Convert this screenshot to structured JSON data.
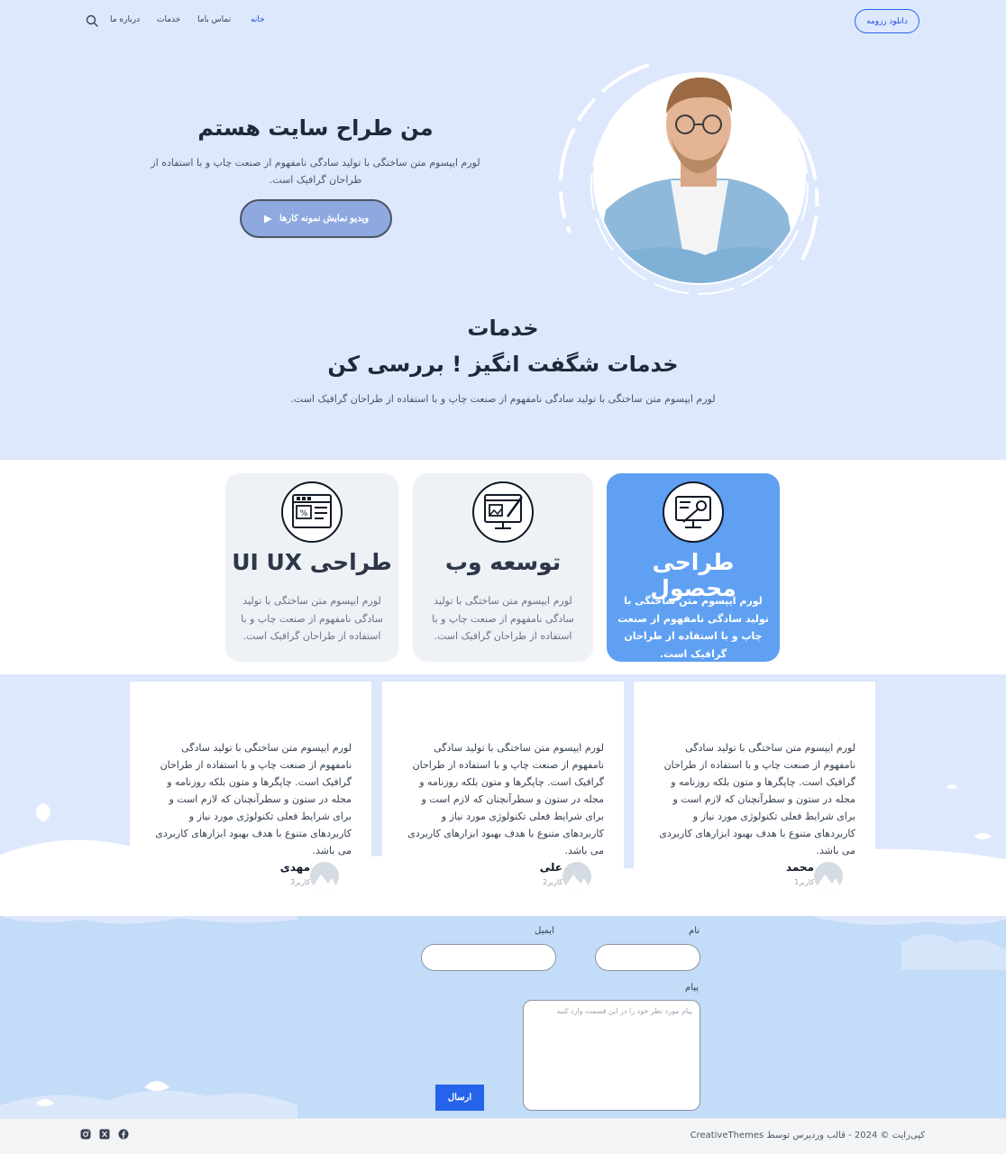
{
  "header": {
    "resume_button": "دانلود رزومه",
    "nav": {
      "home": "خانه",
      "contact": "تماس باما",
      "services": "خدمات",
      "about": "درباره ما"
    }
  },
  "hero": {
    "title": "من طراح سایت هستم",
    "description": "لورم ایپسوم متن ساختگی با تولید سادگی نامفهوم از صنعت چاپ و با استفاده از طراحان گرافیک است.",
    "video_button": "ویدیو نمایش نمونه کارها"
  },
  "services": {
    "kicker": "خدمات",
    "title": "خدمات شگفت انگیز ! بررسی کن",
    "description": "لورم ایپسوم متن ساختگی با تولید سادگی نامفهوم از صنعت چاپ و با استفاده از طراحان گرافیک است.",
    "cards": [
      {
        "title": "طراحی محصول",
        "description": "لورم ایپسوم متن ساختگی با تولید سادگی نامفهوم از صنعت چاپ و با استفاده از طراحان گرافیک است.",
        "icon": "product-design-icon"
      },
      {
        "title": "توسعه وب",
        "description": "لورم ایپسوم متن ساختگی با تولید سادگی نامفهوم از صنعت چاپ و با استفاده از طراحان گرافیک است.",
        "icon": "web-development-icon"
      },
      {
        "title": "طراحی UI UX",
        "description": "لورم ایپسوم متن ساختگی با تولید سادگی نامفهوم از صنعت چاپ و با استفاده از طراحان گرافیک است.",
        "icon": "ui-ux-design-icon"
      }
    ]
  },
  "testimonials": [
    {
      "text": "لورم ایپسوم متن ساختگی با تولید سادگی نامفهوم از صنعت چاپ و با استفاده از طراحان گرافیک است. چاپگرها و متون بلکه روزنامه و مجله در ستون و سطرآنچنان که لازم است و برای شرایط فعلی تکنولوژی مورد نیاز و کاربردهای متنوع با هدف بهبود ابزارهای کاربردی می باشد.",
      "name": "محمد",
      "role": "کاربر1"
    },
    {
      "text": "لورم ایپسوم متن ساختگی با تولید سادگی نامفهوم از صنعت چاپ و با استفاده از طراحان گرافیک است. چاپگرها و متون بلکه روزنامه و مجله در ستون و سطرآنچنان که لازم است و برای شرایط فعلی تکنولوژی مورد نیاز و کاربردهای متنوع با هدف بهبود ابزارهای کاربردی می باشد.",
      "name": "علی",
      "role": "کاربر2"
    },
    {
      "text": "لورم ایپسوم متن ساختگی با تولید سادگی نامفهوم از صنعت چاپ و با استفاده از طراحان گرافیک است. چاپگرها و متون بلکه روزنامه و مجله در ستون و سطرآنچنان که لازم است و برای شرایط فعلی تکنولوژی مورد نیاز و کاربردهای متنوع با هدف بهبود ابزارهای کاربردی می باشد.",
      "name": "مهدی",
      "role": "کاربر3"
    }
  ],
  "contact": {
    "name_label": "نام",
    "email_label": "ایمیل",
    "message_label": "پیام",
    "message_placeholder": "پیام مورد نظر خود را در این قسمت وارد کنید",
    "send_button": "ارسال"
  },
  "footer": {
    "copyright": "کپی‌رایت © 2024 - قالب وردپرس توسط CreativeThemes",
    "social_icons": [
      "facebook-icon",
      "x-icon",
      "instagram-icon"
    ]
  },
  "colors": {
    "accent": "#2563eb",
    "hero_bg": "#dde8fd",
    "active_card": "#5fa0f2",
    "contact_bg": "#c3dcf7"
  }
}
